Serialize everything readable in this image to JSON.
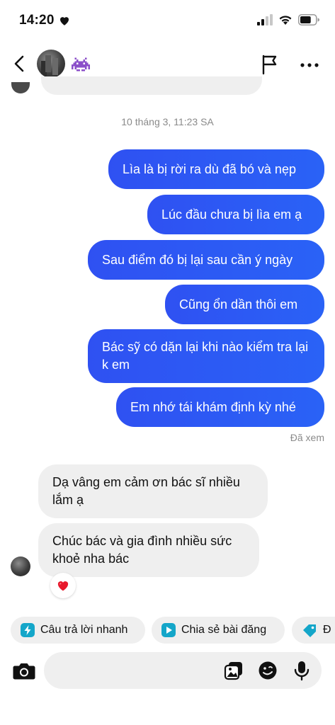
{
  "status_bar": {
    "time": "14:20",
    "heart_icon": "heart-icon",
    "battery_level_percent": 70
  },
  "header": {
    "emoji_icon": "alien-monster-icon"
  },
  "conversation": {
    "timestamp": "10 tháng 3, 11:23 SA",
    "outgoing": [
      "Lìa là bị rời ra dù đã bó và nẹp",
      "Lúc đầu chưa bị lìa em ạ",
      "Sau điểm đó bị lại sau cần ý ngày",
      "Cũng ổn dần thôi em",
      "Bác sỹ có dặn lại khi nào kiểm tra lại k em",
      "Em nhớ tái khám định kỳ nhé"
    ],
    "seen_label": "Đã xem",
    "incoming": [
      "Dạ vâng em cảm ơn bác sĩ nhiều lắm ạ",
      "Chúc bác và gia đình nhiều sức khoẻ nha bác"
    ],
    "reaction": "❤️"
  },
  "quick_actions": [
    {
      "label": "Câu trả lời nhanh",
      "icon": "lightning-icon"
    },
    {
      "label": "Chia sẻ bài đăng",
      "icon": "play-icon"
    },
    {
      "label": "Đ",
      "icon": "tag-icon"
    }
  ],
  "composer": {
    "placeholder": ""
  },
  "colors": {
    "outgoing_bubble": "#2f58f4",
    "incoming_bubble": "#efefef",
    "chip_icon": "#14a6c9"
  }
}
